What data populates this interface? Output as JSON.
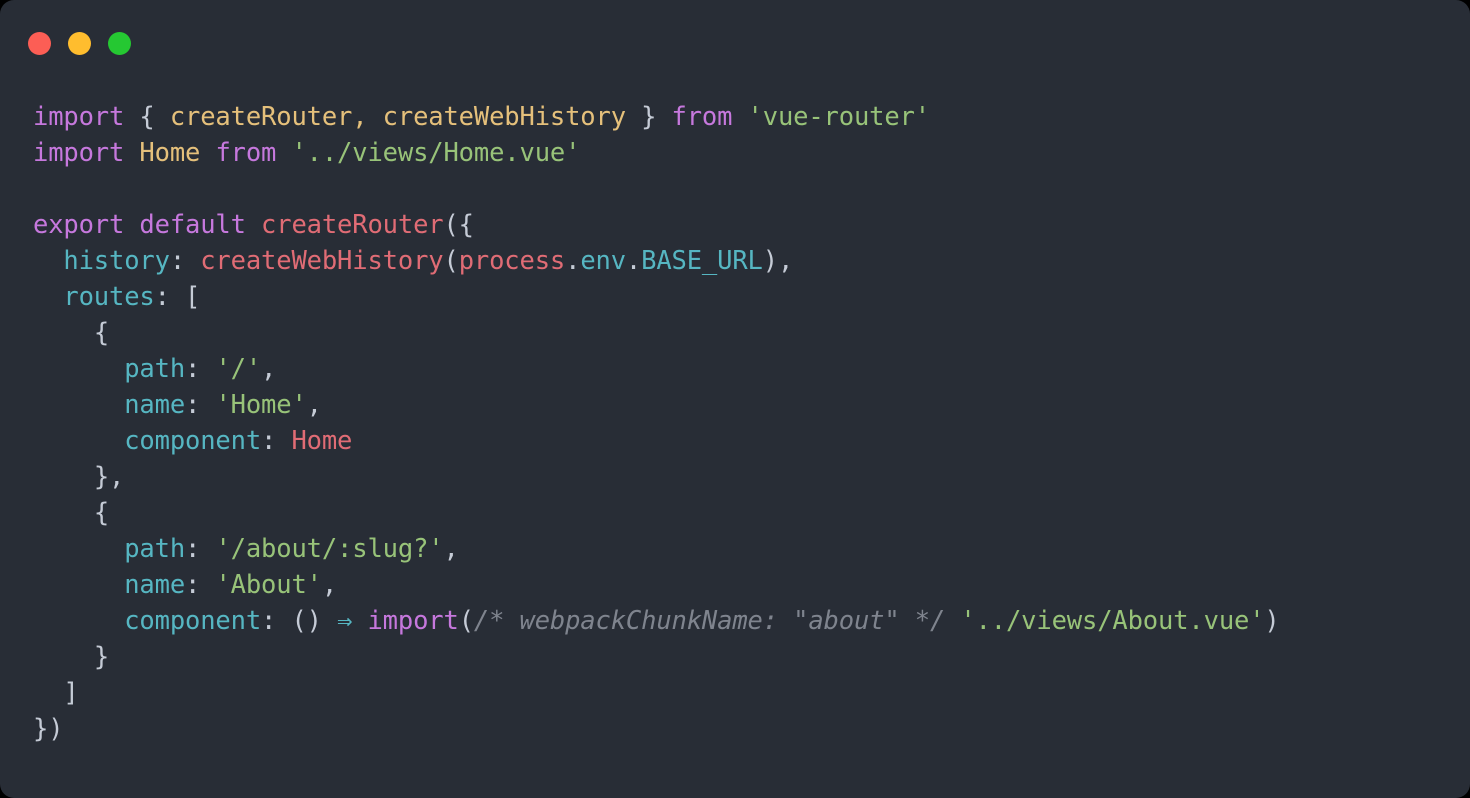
{
  "window": {
    "background_color": "#282d36",
    "corner_radius_px": 14,
    "controls": [
      {
        "name": "close",
        "color": "#fc5e55"
      },
      {
        "name": "minimize",
        "color": "#ffbd2e"
      },
      {
        "name": "maximize",
        "color": "#25c832"
      }
    ]
  },
  "theme": {
    "name": "one-dark",
    "colors": {
      "background": "#282d36",
      "foreground": "#c8cdd6",
      "keyword": "#c678dd",
      "identifier": "#e5c07b",
      "string": "#98c379",
      "punctuation": "#c5cbd6",
      "property": "#56b6c2",
      "function": "#e06c75",
      "variable": "#e06c75",
      "comment": "#7f848e",
      "arrow": "#56b6c2"
    }
  },
  "code": {
    "language": "javascript",
    "font_size_px": 25.5,
    "line_height_px": 36,
    "lines": [
      {
        "n": 1,
        "text": "import { createRouter, createWebHistory } from 'vue-router'",
        "tokens": [
          {
            "t": "import",
            "c": "tok-keyword"
          },
          {
            "t": " ",
            "c": "tok-plain"
          },
          {
            "t": "{",
            "c": "tok-punct"
          },
          {
            "t": " ",
            "c": "tok-plain"
          },
          {
            "t": "createRouter",
            "c": "tok-ident"
          },
          {
            "t": ",",
            "c": "tok-ident"
          },
          {
            "t": " ",
            "c": "tok-plain"
          },
          {
            "t": "createWebHistory",
            "c": "tok-ident"
          },
          {
            "t": " ",
            "c": "tok-plain"
          },
          {
            "t": "}",
            "c": "tok-punct"
          },
          {
            "t": " ",
            "c": "tok-plain"
          },
          {
            "t": "from",
            "c": "tok-keyword"
          },
          {
            "t": " ",
            "c": "tok-plain"
          },
          {
            "t": "'vue-router'",
            "c": "tok-string"
          }
        ]
      },
      {
        "n": 2,
        "text": "import Home from '../views/Home.vue'",
        "tokens": [
          {
            "t": "import",
            "c": "tok-keyword"
          },
          {
            "t": " ",
            "c": "tok-plain"
          },
          {
            "t": "Home",
            "c": "tok-ident"
          },
          {
            "t": " ",
            "c": "tok-plain"
          },
          {
            "t": "from",
            "c": "tok-keyword"
          },
          {
            "t": " ",
            "c": "tok-plain"
          },
          {
            "t": "'../views/Home.vue'",
            "c": "tok-string"
          }
        ]
      },
      {
        "n": 3,
        "text": "",
        "tokens": []
      },
      {
        "n": 4,
        "text": "export default createRouter({",
        "tokens": [
          {
            "t": "export",
            "c": "tok-keyword"
          },
          {
            "t": " ",
            "c": "tok-plain"
          },
          {
            "t": "default",
            "c": "tok-keyword"
          },
          {
            "t": " ",
            "c": "tok-plain"
          },
          {
            "t": "createRouter",
            "c": "tok-func"
          },
          {
            "t": "({",
            "c": "tok-punct"
          }
        ]
      },
      {
        "n": 5,
        "text": "  history: createWebHistory(process.env.BASE_URL),",
        "tokens": [
          {
            "t": "  ",
            "c": "tok-plain"
          },
          {
            "t": "history",
            "c": "tok-prop"
          },
          {
            "t": ":",
            "c": "tok-punct"
          },
          {
            "t": " ",
            "c": "tok-plain"
          },
          {
            "t": "createWebHistory",
            "c": "tok-func"
          },
          {
            "t": "(",
            "c": "tok-punct"
          },
          {
            "t": "process",
            "c": "tok-var"
          },
          {
            "t": ".",
            "c": "tok-punct"
          },
          {
            "t": "env",
            "c": "tok-prop"
          },
          {
            "t": ".",
            "c": "tok-punct"
          },
          {
            "t": "BASE_URL",
            "c": "tok-prop"
          },
          {
            "t": "),",
            "c": "tok-punct"
          }
        ]
      },
      {
        "n": 6,
        "text": "  routes: [",
        "tokens": [
          {
            "t": "  ",
            "c": "tok-plain"
          },
          {
            "t": "routes",
            "c": "tok-prop"
          },
          {
            "t": ":",
            "c": "tok-punct"
          },
          {
            "t": " ",
            "c": "tok-plain"
          },
          {
            "t": "[",
            "c": "tok-punct"
          }
        ]
      },
      {
        "n": 7,
        "text": "    {",
        "tokens": [
          {
            "t": "    ",
            "c": "tok-plain"
          },
          {
            "t": "{",
            "c": "tok-punct"
          }
        ]
      },
      {
        "n": 8,
        "text": "      path: '/',",
        "tokens": [
          {
            "t": "      ",
            "c": "tok-plain"
          },
          {
            "t": "path",
            "c": "tok-prop"
          },
          {
            "t": ":",
            "c": "tok-punct"
          },
          {
            "t": " ",
            "c": "tok-plain"
          },
          {
            "t": "'/'",
            "c": "tok-string"
          },
          {
            "t": ",",
            "c": "tok-punct"
          }
        ]
      },
      {
        "n": 9,
        "text": "      name: 'Home',",
        "tokens": [
          {
            "t": "      ",
            "c": "tok-plain"
          },
          {
            "t": "name",
            "c": "tok-prop"
          },
          {
            "t": ":",
            "c": "tok-punct"
          },
          {
            "t": " ",
            "c": "tok-plain"
          },
          {
            "t": "'Home'",
            "c": "tok-string"
          },
          {
            "t": ",",
            "c": "tok-punct"
          }
        ]
      },
      {
        "n": 10,
        "text": "      component: Home",
        "tokens": [
          {
            "t": "      ",
            "c": "tok-plain"
          },
          {
            "t": "component",
            "c": "tok-prop"
          },
          {
            "t": ":",
            "c": "tok-punct"
          },
          {
            "t": " ",
            "c": "tok-plain"
          },
          {
            "t": "Home",
            "c": "tok-var"
          }
        ]
      },
      {
        "n": 11,
        "text": "    },",
        "tokens": [
          {
            "t": "    ",
            "c": "tok-plain"
          },
          {
            "t": "},",
            "c": "tok-punct"
          }
        ]
      },
      {
        "n": 12,
        "text": "    {",
        "tokens": [
          {
            "t": "    ",
            "c": "tok-plain"
          },
          {
            "t": "{",
            "c": "tok-punct"
          }
        ]
      },
      {
        "n": 13,
        "text": "      path: '/about/:slug?',",
        "tokens": [
          {
            "t": "      ",
            "c": "tok-plain"
          },
          {
            "t": "path",
            "c": "tok-prop"
          },
          {
            "t": ":",
            "c": "tok-punct"
          },
          {
            "t": " ",
            "c": "tok-plain"
          },
          {
            "t": "'/about/:slug?'",
            "c": "tok-string"
          },
          {
            "t": ",",
            "c": "tok-punct"
          }
        ]
      },
      {
        "n": 14,
        "text": "      name: 'About',",
        "tokens": [
          {
            "t": "      ",
            "c": "tok-plain"
          },
          {
            "t": "name",
            "c": "tok-prop"
          },
          {
            "t": ":",
            "c": "tok-punct"
          },
          {
            "t": " ",
            "c": "tok-plain"
          },
          {
            "t": "'About'",
            "c": "tok-string"
          },
          {
            "t": ",",
            "c": "tok-punct"
          }
        ]
      },
      {
        "n": 15,
        "text": "      component: () ⇒ import(/* webpackChunkName: \"about\" */ '../views/About.vue')",
        "tokens": [
          {
            "t": "      ",
            "c": "tok-plain"
          },
          {
            "t": "component",
            "c": "tok-prop"
          },
          {
            "t": ":",
            "c": "tok-punct"
          },
          {
            "t": " ",
            "c": "tok-plain"
          },
          {
            "t": "()",
            "c": "tok-punct"
          },
          {
            "t": " ",
            "c": "tok-plain"
          },
          {
            "t": "⇒",
            "c": "tok-arrow"
          },
          {
            "t": " ",
            "c": "tok-plain"
          },
          {
            "t": "import",
            "c": "tok-keyword"
          },
          {
            "t": "(",
            "c": "tok-punct"
          },
          {
            "t": "/* webpackChunkName: \"about\" */",
            "c": "tok-comment"
          },
          {
            "t": " ",
            "c": "tok-plain"
          },
          {
            "t": "'../views/About.vue'",
            "c": "tok-string"
          },
          {
            "t": ")",
            "c": "tok-punct"
          }
        ]
      },
      {
        "n": 16,
        "text": "    }",
        "tokens": [
          {
            "t": "    ",
            "c": "tok-plain"
          },
          {
            "t": "}",
            "c": "tok-punct"
          }
        ]
      },
      {
        "n": 17,
        "text": "  ]",
        "tokens": [
          {
            "t": "  ",
            "c": "tok-plain"
          },
          {
            "t": "]",
            "c": "tok-punct"
          }
        ]
      },
      {
        "n": 18,
        "text": "})",
        "tokens": [
          {
            "t": "})",
            "c": "tok-punct"
          }
        ]
      }
    ]
  }
}
